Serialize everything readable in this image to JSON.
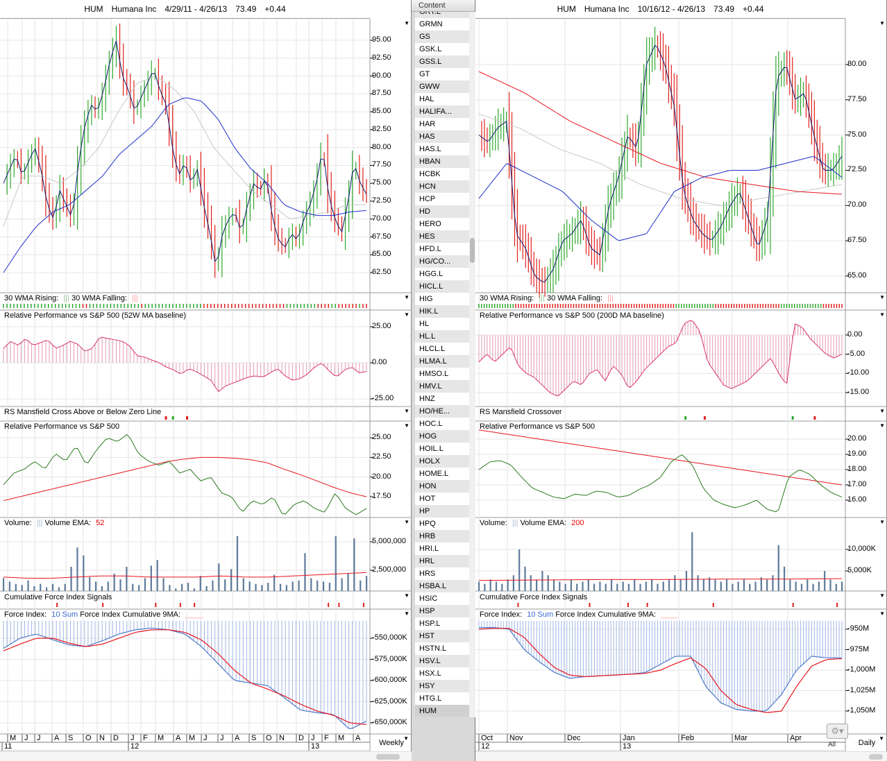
{
  "left": {
    "header": {
      "symbol": "HUM",
      "name": "Humana Inc",
      "range": "4/29/11 - 4/26/13",
      "price": "73.49",
      "change": "+0.44"
    },
    "period": "Weekly",
    "panels": {
      "wma": {
        "rising": "30 WMA Rising:",
        "rising_icon": "|||",
        "falling": "30 WMA Falling:",
        "falling_icon": "|||"
      },
      "relperf_hist": {
        "title": "Relative Performance vs S&P 500 (52W MA baseline)"
      },
      "mansfield": {
        "title": "RS Mansfield Cross Above or Below Zero Line"
      },
      "relperf_line": {
        "title": "Relative Performance vs S&P 500"
      },
      "volume": {
        "label": "Volume:",
        "icon": "|||",
        "ema_label": "Volume EMA:",
        "ema_value": "52"
      },
      "cfi": {
        "title": "Cumulative Force Index Signals"
      },
      "force": {
        "label": "Force Index:",
        "sum": "10 Sum",
        "cum_label": "Force Index Cumulative 9MA:"
      }
    },
    "months": [
      "M",
      "J",
      "J",
      "A",
      "S",
      "O",
      "N",
      "D",
      "J",
      "F",
      "M",
      "A",
      "M",
      "J",
      "J",
      "A",
      "S",
      "O",
      "N",
      "D",
      "J",
      "F",
      "M",
      "A"
    ],
    "years": [
      "11",
      "12",
      "13"
    ]
  },
  "right": {
    "header": {
      "symbol": "HUM",
      "name": "Humana Inc",
      "range": "10/16/12 - 4/26/13",
      "price": "73.49",
      "change": "+0.44"
    },
    "period": "Daily",
    "panels": {
      "wma": {
        "rising": "30 WMA Rising:",
        "rising_icon": "|||",
        "falling": "30 WMA Falling:",
        "falling_icon": "|||"
      },
      "relperf_hist": {
        "title": "Relative Performance vs S&P 500 (200D MA baseline)"
      },
      "mansfield": {
        "title": "RS Mansfield Crossover"
      },
      "relperf_line": {
        "title": "Relative Performance vs S&P 500"
      },
      "volume": {
        "label": "Volume:",
        "icon": "|||",
        "ema_label": "Volume EMA:",
        "ema_value": "200"
      },
      "cfi": {
        "title": "Cumulative Force Index Signals"
      },
      "force": {
        "label": "Force Index:",
        "sum": "10 Sum",
        "cum_label": "Force Index Cumulative 9MA:"
      }
    },
    "months": [
      "Oct",
      "Nov",
      "Dec",
      "Jan",
      "Feb",
      "Mar",
      "Apr"
    ],
    "years": [
      "12",
      "13"
    ]
  },
  "watchlist": {
    "header": "Content",
    "items": [
      "GRT.L",
      "GRMN",
      "GS",
      "GSK.L",
      "GSS.L",
      "GT",
      "GWW",
      "HAL",
      "HALIFA...",
      "HAR",
      "HAS",
      "HAS.L",
      "HBAN",
      "HCBK",
      "HCN",
      "HCP",
      "HD",
      "HERO",
      "HES",
      "HFD.L",
      "HG/CO...",
      "HGG.L",
      "HICL.L",
      "HIG",
      "HIK.L",
      "HL",
      "HL.L",
      "HLCL.L",
      "HLMA.L",
      "HMSO.L",
      "HMV.L",
      "HNZ",
      "HO/HE...",
      "HOC.L",
      "HOG",
      "HOIL.L",
      "HOLX",
      "HOME.L",
      "HON",
      "HOT",
      "HP",
      "HPQ",
      "HRB",
      "HRI.L",
      "HRL",
      "HRS",
      "HSBA.L",
      "HSIC",
      "HSP",
      "HSP.L",
      "HST",
      "HSTN.L",
      "HSV.L",
      "HSX.L",
      "HSY",
      "HTG.L",
      "HUM"
    ],
    "all_label": "All"
  },
  "colors": {
    "up": "#2fa82f",
    "down": "#e0201c",
    "ma_blue": "#1f2fc8",
    "ma_gray": "#c8c8c8",
    "ma_red": "#e8141e",
    "hist": "#d8336e",
    "rel_green": "#2a7a1e",
    "vol": "#5d7a9a",
    "force": "#4a78c8"
  },
  "chart_data": [
    {
      "type": "line",
      "name": "left-weekly",
      "bars": 104,
      "price": {
        "ylim": [
          60,
          97
        ],
        "ticks": [
          "95.00",
          "92.50",
          "90.00",
          "87.50",
          "85.00",
          "82.50",
          "80.00",
          "77.50",
          "75.00",
          "72.50",
          "70.00",
          "67.50",
          "65.00",
          "62.50"
        ],
        "close": [
          75,
          77,
          79,
          76,
          78,
          80,
          77,
          72,
          70,
          74,
          72,
          70,
          78,
          83,
          86,
          85,
          88,
          92,
          95,
          90,
          88,
          85,
          87,
          89,
          91,
          88,
          86,
          80,
          76,
          78,
          75,
          77,
          72,
          68,
          63,
          68,
          70,
          71,
          68,
          72,
          75,
          74,
          76,
          70,
          67,
          66,
          68,
          67,
          70,
          72,
          75,
          80,
          73,
          70,
          68,
          72,
          78,
          75,
          73.5
        ],
        "wma_blue": [
          62.5,
          66,
          69,
          71,
          72,
          74,
          76,
          79,
          81,
          83,
          86,
          87,
          86.5,
          84,
          80,
          77,
          75,
          72,
          71,
          70.5,
          70.5,
          71,
          71.2
        ],
        "ma_gray": [
          69,
          76,
          76,
          75,
          77,
          80,
          85,
          89,
          90,
          88,
          85,
          80,
          77,
          74,
          72,
          70,
          70.5,
          71,
          72,
          72
        ]
      },
      "wma_signal": "GGGGGGGGGGGGGGGGGGGGGGGRRGGGGGGGGGGGGGGGRGGGGGGGGGGGGGGGGGRRRRRRRRRRRRRRRRRRRRRRRRGGGGGGGGGRRRRGGRRRRRRGRR",
      "relperf_hist": {
        "ticks": [
          "25.00",
          "0.00",
          "-25.00"
        ],
        "values": [
          10,
          15,
          12,
          17,
          12,
          14,
          16,
          10,
          12,
          15,
          13,
          8,
          10,
          18,
          17,
          16,
          15,
          12,
          5,
          4,
          2,
          0,
          -3,
          -5,
          -8,
          -4,
          -6,
          -9,
          -12,
          -20,
          -16,
          -14,
          -12,
          -10,
          -9,
          -10,
          -7,
          -4,
          -9,
          -12,
          -11,
          -8,
          -3,
          0,
          -6,
          -10,
          -5,
          -3,
          -7,
          -6
        ]
      },
      "mansfield": [
        {
          "bar": 46,
          "sig": "down"
        },
        {
          "bar": 48,
          "sig": "up"
        },
        {
          "bar": 52,
          "sig": "down"
        }
      ],
      "relperf_line": {
        "ticks": [
          "25.00",
          "22.50",
          "20.00",
          "17.50"
        ],
        "green": [
          19,
          20.5,
          21,
          22,
          21,
          23,
          22,
          24,
          21.5,
          23.5,
          25,
          24.5,
          25.5,
          23,
          22,
          21.5,
          22,
          20.5,
          21,
          19.5,
          20,
          18,
          17.5,
          15.5,
          17,
          16.5,
          17.5,
          15,
          16.5,
          17,
          16,
          15.5,
          18,
          16,
          15.2,
          16
        ],
        "red": [
          17,
          17.5,
          18,
          18.5,
          19,
          19.5,
          20,
          20.5,
          21,
          21.5,
          22,
          22.3,
          22.5,
          22.5,
          22.4,
          22.2,
          21.8,
          21,
          20.3,
          19.5,
          18.7,
          18,
          17.5
        ]
      },
      "volume": {
        "ticks": [
          "5,000,000",
          "2,500,000"
        ],
        "values": [
          1.8,
          1.5,
          1.3,
          1.2,
          1.6,
          1.1,
          1.3,
          1.0,
          1.3,
          1.0,
          1.3,
          2.8,
          4.5,
          3.8,
          1.9,
          1.5,
          1.1,
          1.5,
          2.2,
          1.7,
          2.8,
          1.3,
          1.2,
          1.8,
          2.9,
          3.4,
          1.8,
          1.2,
          0.9,
          1.3,
          1.4,
          0.9,
          2.0,
          1.1,
          1.6,
          3.1,
          1.7,
          2.6,
          5.5,
          1.8,
          1.5,
          1.3,
          1.2,
          1.4,
          2.1,
          1.3,
          1.2,
          1.5,
          1.6,
          4.0,
          1.8,
          1.6,
          1.5,
          1.4,
          5.5,
          1.8,
          2.2,
          5.3,
          1.6,
          2.0
        ],
        "ema": [
          1.9,
          1.8,
          1.8,
          1.9,
          2.0,
          2.0,
          1.9,
          1.9,
          1.9,
          2.0,
          1.9,
          1.9,
          2.0,
          2.1,
          2.2,
          2.3
        ]
      },
      "cfi_signals": [
        15,
        28,
        43,
        50,
        54,
        92,
        95,
        102
      ],
      "force": {
        "ticks": [
          "-550,000K",
          "-575,000K",
          "-600,000K",
          "-625,000K",
          "-650,000K"
        ],
        "sum": [
          -562,
          -550,
          -545,
          -552,
          -558,
          -560,
          -553,
          -545,
          -540,
          -538,
          -540,
          -545,
          -560,
          -580,
          -600,
          -603,
          -606,
          -620,
          -635,
          -638,
          -640,
          -658,
          -648
        ],
        "cum9": [
          -565,
          -557,
          -550,
          -550,
          -556,
          -560,
          -557,
          -550,
          -543,
          -540,
          -540,
          -543,
          -552,
          -568,
          -588,
          -603,
          -610,
          -618,
          -628,
          -636,
          -641,
          -650,
          -652
        ]
      }
    },
    {
      "type": "line",
      "name": "right-daily",
      "bars": 133,
      "price": {
        "ylim": [
          63,
          83.5
        ],
        "ticks": [
          "80.00",
          "77.50",
          "75.00",
          "72.50",
          "70.00",
          "67.50",
          "65.00"
        ],
        "close": [
          75,
          74.5,
          75.5,
          76,
          68,
          67,
          65,
          64.5,
          65.5,
          67.5,
          68,
          69,
          67,
          66.5,
          70,
          72,
          75,
          74,
          80,
          81.5,
          80,
          77,
          71,
          69,
          68,
          67.5,
          68.5,
          70,
          71,
          69,
          67,
          69,
          79,
          80,
          77.5,
          78,
          75,
          72.5,
          72.5,
          73.5
        ],
        "wma_blue": [
          70.5,
          73,
          72,
          71,
          69,
          67.5,
          68,
          71,
          72,
          72.5,
          72.5,
          73,
          73.5,
          72
        ],
        "ma_gray": [
          76.5,
          75.5,
          74,
          73,
          71.5,
          70.5,
          70,
          70.5,
          71,
          71.5
        ],
        "ma_red": [
          79.5,
          78,
          76,
          74.5,
          73,
          72,
          71.5,
          71,
          70.8
        ]
      },
      "wma_signal": "GGGGGGGGGGGGGGRRRRRRRRRRRRRRRRRRRRRRRRRRRRRRRRRRRRRRRRRRRRRRRRRRRRRRRRRRRRRGGGGGGGGGGGGGGGRRRRRRRRRRRRRRRRRRRRRRRRRGGGGGGGGGGGGGGGGRRRRRRRR",
      "relperf_hist": {
        "ticks": [
          "0.00",
          "-5.00",
          "-10.00",
          "-15.00"
        ],
        "values": [
          -7,
          -5,
          -7,
          -5,
          -3,
          -8,
          -10,
          -11,
          -13,
          -15,
          -16,
          -14,
          -12,
          -13,
          -10,
          -9,
          -12,
          -8,
          -10,
          -14,
          -12,
          -9,
          -7,
          -5,
          -3,
          -2,
          3,
          4,
          1,
          -7,
          -10,
          -13,
          -14,
          -13,
          -12,
          -10,
          -8,
          -6,
          -10,
          -13,
          3,
          2,
          -1,
          -3,
          -5,
          -6,
          -5
        ]
      },
      "mansfield": [
        {
          "bar": 75,
          "sig": "up"
        },
        {
          "bar": 82,
          "sig": "down"
        },
        {
          "bar": 114,
          "sig": "up"
        },
        {
          "bar": 122,
          "sig": "down"
        }
      ],
      "relperf_line": {
        "ticks": [
          "20.00",
          "19.00",
          "18.00",
          "17.00",
          "16.00"
        ],
        "green": [
          18,
          18.5,
          18.6,
          18.3,
          17.5,
          16.8,
          16.5,
          16.2,
          16.1,
          16.4,
          16.3,
          16.6,
          16.5,
          16.2,
          16.3,
          16.7,
          17,
          17.5,
          18.5,
          19,
          18.3,
          16.8,
          16,
          15.7,
          15.5,
          15.7,
          16,
          15.4,
          15.2,
          17.5,
          18,
          17.7,
          17,
          16.5,
          16.2
        ],
        "red": [
          20.6,
          17
        ]
      },
      "volume": {
        "ticks": [
          "10,000K",
          "5,000K"
        ],
        "values": [
          2.5,
          2,
          3,
          2.5,
          2,
          3,
          4,
          10,
          6,
          4,
          3,
          5,
          4,
          3,
          2.5,
          2,
          3,
          2,
          2.5,
          3,
          2,
          2.5,
          2,
          3,
          2,
          2.5,
          2,
          3,
          2,
          2.5,
          3,
          2,
          2.5,
          3,
          4,
          3,
          5,
          14,
          4,
          3,
          3.5,
          3,
          2.5,
          3,
          2,
          2.5,
          3,
          2,
          2.5,
          3.5,
          3,
          4,
          11,
          6,
          3,
          2.5,
          2,
          3,
          2,
          2.5,
          5,
          3,
          2,
          2.5
        ],
        "ema": [
          2.8,
          2.9,
          3.0,
          3.0,
          3.1,
          3.1,
          3.2
        ]
      },
      "cfi_signals": [
        14,
        40,
        54,
        61,
        85,
        114,
        130
      ],
      "force": {
        "ticks": [
          "-950M",
          "-975M",
          "-1,000M",
          "-1,025M",
          "-1,050M"
        ],
        "sum": [
          -948,
          -948,
          -950,
          -975,
          -990,
          -1003,
          -1010,
          -1008,
          -1007,
          -1006,
          -1005,
          -1003,
          -993,
          -983,
          -983,
          -1020,
          -1040,
          -1048,
          -1050,
          -1050,
          -1030,
          -1000,
          -983,
          -985,
          -985
        ],
        "cum9": [
          -950,
          -949,
          -949,
          -960,
          -980,
          -997,
          -1006,
          -1008,
          -1007,
          -1006,
          -1005,
          -1004,
          -1000,
          -992,
          -985,
          -998,
          -1025,
          -1042,
          -1048,
          -1052,
          -1050,
          -1020,
          -995,
          -987,
          -986
        ]
      }
    }
  ]
}
